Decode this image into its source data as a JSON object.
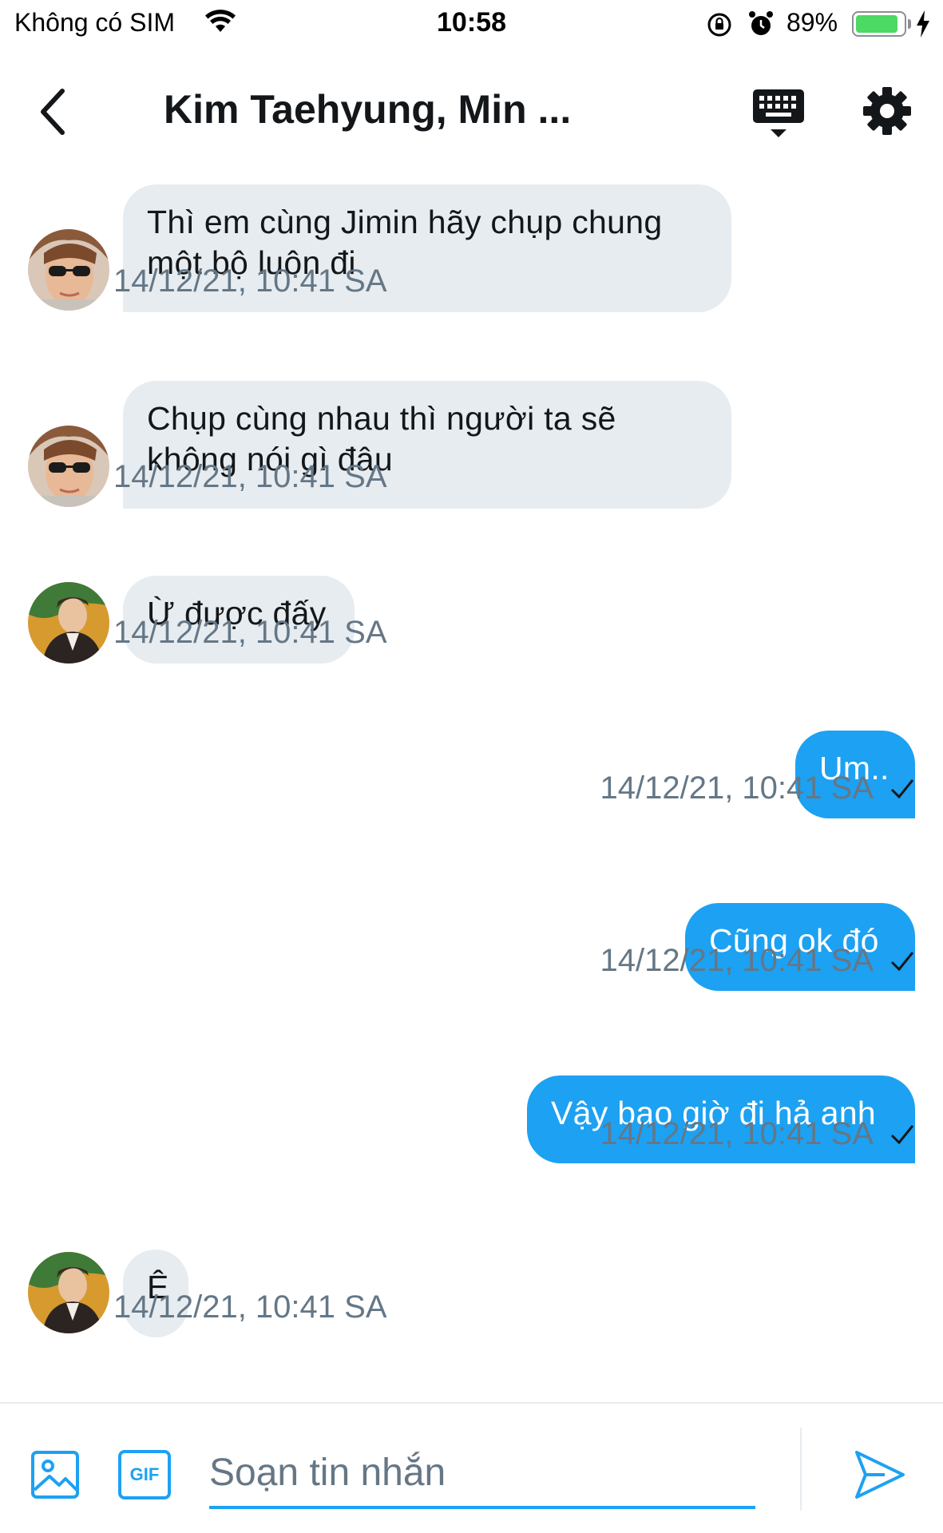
{
  "status_bar": {
    "carrier": "Không có SIM",
    "time": "10:58",
    "battery_percent": "89%",
    "battery_level": 0.89,
    "icons": [
      "wifi-icon",
      "orientation-lock-icon",
      "alarm-icon",
      "battery-icon",
      "charging-bolt-icon"
    ]
  },
  "header": {
    "title": "Kim Taehyung, Min ...",
    "icons": [
      "back-chevron-icon",
      "keyboard-icon",
      "gear-icon"
    ]
  },
  "messages": [
    {
      "direction": "in",
      "text": "Thì em cùng Jimin hãy chụp chung một bộ luôn đi",
      "time": "14/12/21, 10:41 SA",
      "avatar": "avatar-sunglasses"
    },
    {
      "direction": "in",
      "text": "Chụp cùng nhau thì người ta sẽ không nói gì đâu",
      "time": "14/12/21, 10:41 SA",
      "avatar": "avatar-sunglasses"
    },
    {
      "direction": "in",
      "text": "Ừ được đấy",
      "time": "14/12/21, 10:41 SA",
      "avatar": "avatar-suit"
    },
    {
      "direction": "out",
      "text": "Um..",
      "time": "14/12/21, 10:41 SA",
      "status": "sent-check-icon"
    },
    {
      "direction": "out",
      "text": "Cũng ok đó",
      "time": "14/12/21, 10:41 SA",
      "status": "sent-check-icon"
    },
    {
      "direction": "out",
      "text": "Vậy bao giờ đi hả anh",
      "time": "14/12/21, 10:41 SA",
      "status": "sent-check-icon"
    },
    {
      "direction": "in",
      "text": "Ê",
      "time": "14/12/21, 10:41 SA",
      "avatar": "avatar-suit"
    }
  ],
  "composer": {
    "placeholder": "Soạn tin nhắn",
    "gif_label": "GIF",
    "icons": [
      "image-icon",
      "gif-icon",
      "send-icon"
    ]
  },
  "colors": {
    "accent": "#1da1f2",
    "incoming_bubble": "#e6ecf0",
    "timestamp": "#657786",
    "title": "#14171a"
  }
}
